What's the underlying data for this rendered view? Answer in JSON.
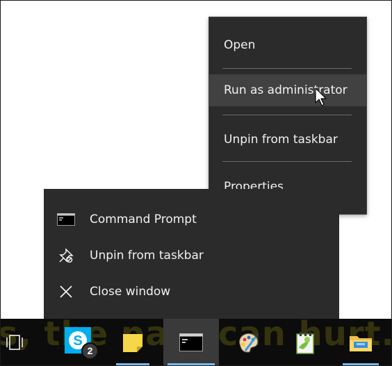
{
  "context_menu": {
    "items": [
      {
        "label": "Open"
      },
      {
        "label": "Run as administrator"
      },
      {
        "label": "Unpin from taskbar"
      },
      {
        "label": "Properties"
      }
    ]
  },
  "jump_list": {
    "items": [
      {
        "label": "Command Prompt",
        "icon": "cmd-app-icon"
      },
      {
        "label": "Unpin from taskbar",
        "icon": "unpin-icon"
      },
      {
        "label": "Close window",
        "icon": "close-icon"
      }
    ]
  },
  "taskbar": {
    "wallpaper_text": "s, the past can hurt.",
    "items": [
      {
        "name": "task-view",
        "icon": "task-view-icon"
      },
      {
        "name": "skype",
        "icon": "skype-icon",
        "badge": "2"
      },
      {
        "name": "sticky-notes",
        "icon": "sticky-notes-icon"
      },
      {
        "name": "command-prompt",
        "icon": "cmd-icon",
        "active": true
      },
      {
        "name": "paint",
        "icon": "paint-icon"
      },
      {
        "name": "notepad-plus-plus",
        "icon": "notepad-icon"
      },
      {
        "name": "file-explorer",
        "icon": "file-explorer-icon"
      }
    ]
  },
  "colors": {
    "menu_bg": "#2b2b2b",
    "menu_hover": "#414141",
    "taskbar_bg": "#0c0c0c",
    "active_indicator": "#76b9ed",
    "skype_blue": "#00aff0"
  }
}
